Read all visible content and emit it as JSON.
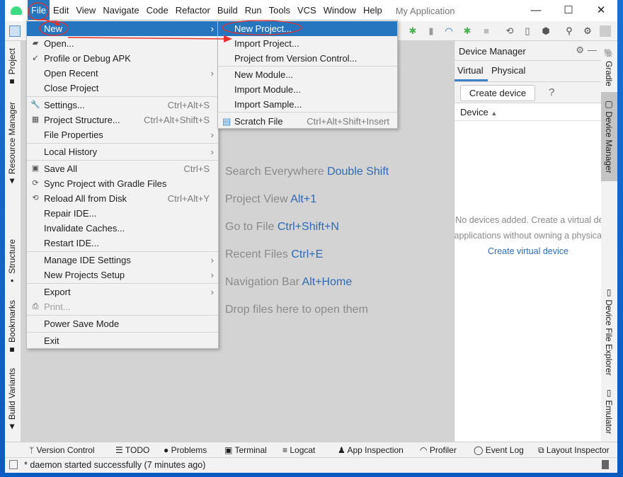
{
  "app_title": "My Application",
  "menubar": [
    "File",
    "Edit",
    "View",
    "Navigate",
    "Code",
    "Refactor",
    "Build",
    "Run",
    "Tools",
    "VCS",
    "Window",
    "Help"
  ],
  "window_controls": {
    "minimize": "—",
    "maximize": "☐",
    "close": "✕"
  },
  "file_menu": [
    {
      "label": "New",
      "arrow": "›",
      "selected": true
    },
    {
      "label": "Open...",
      "icon": "folder-icon"
    },
    {
      "label": "Profile or Debug APK",
      "icon": "profile-apk-icon"
    },
    {
      "label": "Open Recent",
      "arrow": "›"
    },
    {
      "label": "Close Project"
    },
    {
      "label": "Settings...",
      "shortcut": "Ctrl+Alt+S",
      "icon": "wrench-icon"
    },
    {
      "label": "Project Structure...",
      "shortcut": "Ctrl+Alt+Shift+S",
      "icon": "project-structure-icon"
    },
    {
      "label": "File Properties",
      "arrow": "›"
    },
    {
      "label": "Local History",
      "arrow": "›"
    },
    {
      "label": "Save All",
      "shortcut": "Ctrl+S",
      "icon": "save-icon"
    },
    {
      "label": "Sync Project with Gradle Files",
      "icon": "gradle-sync-icon"
    },
    {
      "label": "Reload All from Disk",
      "shortcut": "Ctrl+Alt+Y",
      "icon": "reload-icon"
    },
    {
      "label": "Repair IDE..."
    },
    {
      "label": "Invalidate Caches..."
    },
    {
      "label": "Restart IDE..."
    },
    {
      "label": "Manage IDE Settings",
      "arrow": "›"
    },
    {
      "label": "New Projects Setup",
      "arrow": "›"
    },
    {
      "label": "Export",
      "arrow": "›"
    },
    {
      "label": "Print...",
      "disabled": true,
      "icon": "print-icon"
    },
    {
      "label": "Power Save Mode"
    },
    {
      "label": "Exit"
    }
  ],
  "new_submenu": [
    {
      "label": "New Project...",
      "selected": true
    },
    {
      "label": "Import Project..."
    },
    {
      "label": "Project from Version Control..."
    },
    {
      "label": "New Module..."
    },
    {
      "label": "Import Module..."
    },
    {
      "label": "Import Sample..."
    },
    {
      "label": "Scratch File",
      "shortcut": "Ctrl+Alt+Shift+Insert",
      "icon": "scratch-file-icon"
    }
  ],
  "left_tool_windows": [
    "Project",
    "Resource Manager",
    "Structure",
    "Bookmarks",
    "Build Variants"
  ],
  "right_tool_windows": [
    "Gradle",
    "Device Manager",
    "Device File Explorer",
    "Emulator"
  ],
  "editor_hints": [
    {
      "text": "Search Everywhere",
      "shortcut": "Double Shift"
    },
    {
      "text": "Project View",
      "shortcut": "Alt+1"
    },
    {
      "text": "Go to File",
      "shortcut": "Ctrl+Shift+N"
    },
    {
      "text": "Recent Files",
      "shortcut": "Ctrl+E"
    },
    {
      "text": "Navigation Bar",
      "shortcut": "Alt+Home"
    },
    {
      "text": "Drop files here to open them",
      "shortcut": ""
    }
  ],
  "device_manager": {
    "title": "Device Manager",
    "tabs": [
      "Virtual",
      "Physical"
    ],
    "create_button": "Create device",
    "help": "?",
    "column": "Device",
    "empty_line1": "No devices added. Create a virtual device",
    "empty_line2": "to test applications without owning a physical device.",
    "create_link": "Create virtual device"
  },
  "bottom_tools": [
    "Version Control",
    "TODO",
    "Problems",
    "Terminal",
    "Logcat",
    "App Inspection",
    "Profiler",
    "Event Log",
    "Layout Inspector"
  ],
  "status": "* daemon started successfully (7 minutes ago)",
  "colors": {
    "accent": "#2675bf",
    "annotation": "#e8302a",
    "link": "#2d6bb5"
  }
}
